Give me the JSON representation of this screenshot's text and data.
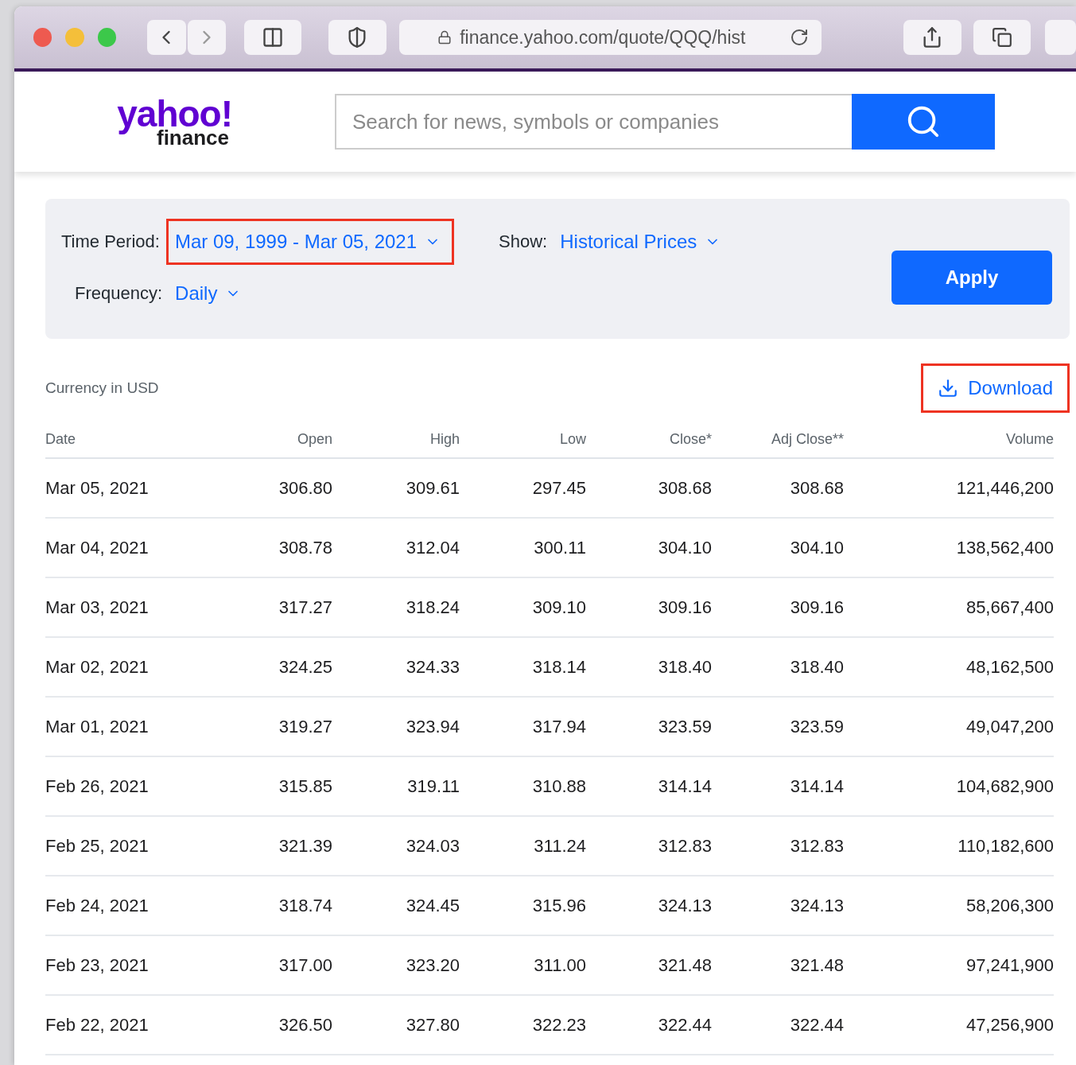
{
  "browser": {
    "url": "finance.yahoo.com/quote/QQQ/hist"
  },
  "logo": {
    "wordmark": "yahoo!",
    "sub": "finance"
  },
  "search": {
    "placeholder": "Search for news, symbols or companies"
  },
  "filters": {
    "time_period": {
      "label": "Time Period:",
      "value": "Mar 09, 1999 - Mar 05, 2021",
      "highlighted": true
    },
    "show": {
      "label": "Show:",
      "value": "Historical Prices"
    },
    "frequency": {
      "label": "Frequency:",
      "value": "Daily"
    },
    "apply_button": "Apply"
  },
  "currency_note": "Currency in USD",
  "download": {
    "label": "Download",
    "highlighted": true
  },
  "table": {
    "columns": [
      "Date",
      "Open",
      "High",
      "Low",
      "Close*",
      "Adj Close**",
      "Volume"
    ],
    "rows": [
      [
        "Mar 05, 2021",
        "306.80",
        "309.61",
        "297.45",
        "308.68",
        "308.68",
        "121,446,200"
      ],
      [
        "Mar 04, 2021",
        "308.78",
        "312.04",
        "300.11",
        "304.10",
        "304.10",
        "138,562,400"
      ],
      [
        "Mar 03, 2021",
        "317.27",
        "318.24",
        "309.10",
        "309.16",
        "309.16",
        "85,667,400"
      ],
      [
        "Mar 02, 2021",
        "324.25",
        "324.33",
        "318.14",
        "318.40",
        "318.40",
        "48,162,500"
      ],
      [
        "Mar 01, 2021",
        "319.27",
        "323.94",
        "317.94",
        "323.59",
        "323.59",
        "49,047,200"
      ],
      [
        "Feb 26, 2021",
        "315.85",
        "319.11",
        "310.88",
        "314.14",
        "314.14",
        "104,682,900"
      ],
      [
        "Feb 25, 2021",
        "321.39",
        "324.03",
        "311.24",
        "312.83",
        "312.83",
        "110,182,600"
      ],
      [
        "Feb 24, 2021",
        "318.74",
        "324.45",
        "315.96",
        "324.13",
        "324.13",
        "58,206,300"
      ],
      [
        "Feb 23, 2021",
        "317.00",
        "323.20",
        "311.00",
        "321.48",
        "321.48",
        "97,241,900"
      ],
      [
        "Feb 22, 2021",
        "326.50",
        "327.80",
        "322.23",
        "322.44",
        "322.44",
        "47,256,900"
      ]
    ]
  }
}
